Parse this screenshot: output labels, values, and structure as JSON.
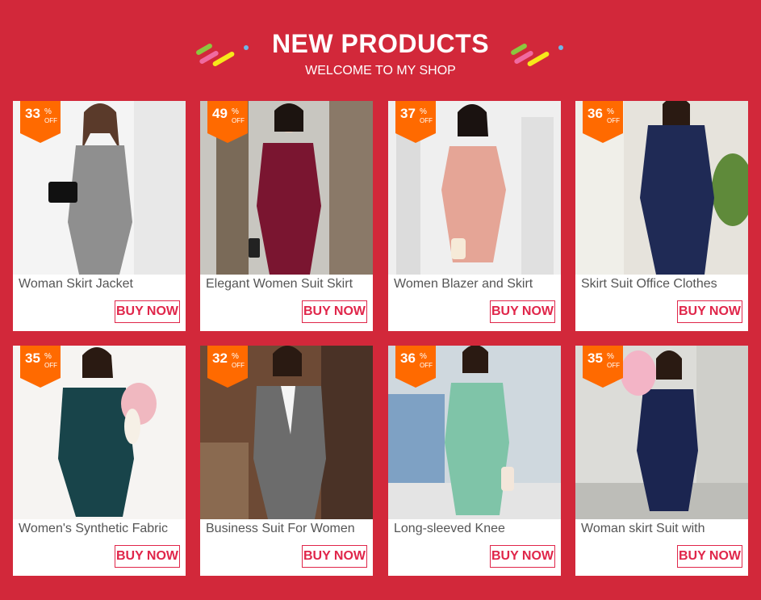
{
  "header": {
    "title": "NEW PRODUCTS",
    "subtitle": "WELCOME TO MY SHOP"
  },
  "colors": {
    "background": "#d2283a",
    "badge": "#ff6a00",
    "buy_button": "#e0264a"
  },
  "products": [
    {
      "discount": "33",
      "pct": "%",
      "off": "OFF",
      "name": "Woman Skirt Jacket",
      "buy": "BUY NOW",
      "suit_color": "#8f8f8f"
    },
    {
      "discount": "49",
      "pct": "%",
      "off": "OFF",
      "name": "Elegant Women Suit Skirt",
      "buy": "BUY NOW",
      "suit_color": "#7a1530"
    },
    {
      "discount": "37",
      "pct": "%",
      "off": "OFF",
      "name": "Women Blazer and Skirt",
      "buy": "BUY NOW",
      "suit_color": "#e5a596"
    },
    {
      "discount": "36",
      "pct": "%",
      "off": "OFF",
      "name": "Skirt Suit Office Clothes",
      "buy": "BUY NOW",
      "suit_color": "#1f2a55"
    },
    {
      "discount": "35",
      "pct": "%",
      "off": "OFF",
      "name": "Women's Synthetic Fabric",
      "buy": "BUY NOW",
      "suit_color": "#18444a"
    },
    {
      "discount": "32",
      "pct": "%",
      "off": "OFF",
      "name": "Business Suit For Women",
      "buy": "BUY NOW",
      "suit_color": "#6c6c6c"
    },
    {
      "discount": "36",
      "pct": "%",
      "off": "OFF",
      "name": "Long-sleeved Knee",
      "buy": "BUY NOW",
      "suit_color": "#7fc4a8"
    },
    {
      "discount": "35",
      "pct": "%",
      "off": "OFF",
      "name": "Woman skirt Suit with",
      "buy": "BUY NOW",
      "suit_color": "#1b2550"
    }
  ]
}
